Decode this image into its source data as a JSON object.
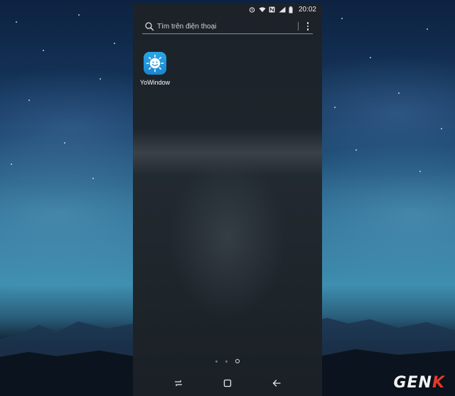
{
  "status_bar": {
    "time": "20:02",
    "icons": [
      "alarm-icon",
      "wifi-icon",
      "nfc-icon",
      "signal-icon",
      "battery-icon"
    ]
  },
  "search": {
    "placeholder": "Tìm trên điện thoại",
    "icon": "search-icon",
    "menu_icon": "more-vertical-icon"
  },
  "apps": [
    {
      "label": "YoWindow",
      "icon": "yowindow-sun-icon",
      "color": "#1e94dc"
    }
  ],
  "page_indicator": {
    "pages": 3,
    "current": 3
  },
  "nav_bar": {
    "buttons": [
      "recent-apps-icon",
      "home-icon",
      "back-icon"
    ]
  },
  "watermark": {
    "text_main": "GEN",
    "text_accent": "K",
    "accent_color": "#e33a2b"
  }
}
